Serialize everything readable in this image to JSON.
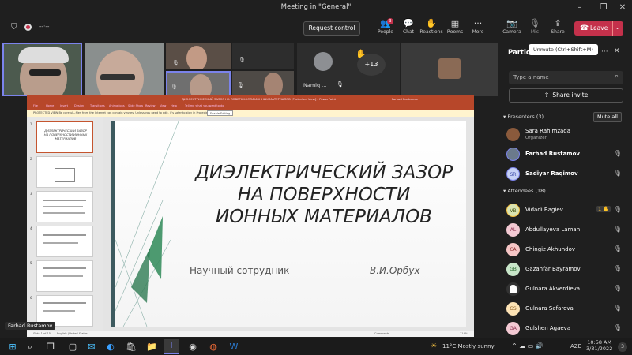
{
  "window": {
    "title": "Meeting in \"General\""
  },
  "toolbar": {
    "timer": "--:--",
    "request_control": "Request control",
    "people": {
      "label": "People",
      "badge": "3"
    },
    "chat": "Chat",
    "reactions": "Reactions",
    "rooms": "Rooms",
    "more": "More",
    "camera": "Camera",
    "mic": "Mic",
    "share": "Share",
    "leave": "Leave"
  },
  "video": {
    "namiq_label": "Namiq ...",
    "more_count": "+13",
    "speaker_label": "Farhad Rustamov"
  },
  "powerpoint": {
    "title_bar": "ДИЭЛЕКТРИЧЕСКИЙ ЗАЗОР НА ПОВЕРХНОСТИ ИОННЫХ МАТЕРИАЛОВ [Protected View] - PowerPoint",
    "user": "Farhad Rustamov",
    "tabs": [
      "File",
      "Home",
      "Insert",
      "Design",
      "Transitions",
      "Animations",
      "Slide Show",
      "Review",
      "View",
      "Help"
    ],
    "tell_me": "Tell me what you want to do",
    "protected_msg": "PROTECTED VIEW  Be careful—files from the Internet can contain viruses. Unless you need to edit, it's safer to stay in Protected View.",
    "enable_editing": "Enable Editing",
    "status_left": "Slide 1 of 15",
    "status_lang": "English (United States)",
    "status_comments": "Comments",
    "status_zoom": "114%",
    "thumbnail_numbers": [
      "1",
      "2",
      "3",
      "4",
      "5",
      "6"
    ],
    "thumb1_text": "ДИЭЛЕКТРИЧЕСКИЙ ЗАЗОР НА ПОВЕРХНОСТИ ИОННЫХ МАТЕРИАЛОВ",
    "slide": {
      "title_line1": "ДИЭЛЕКТРИЧЕСКИЙ  ЗАЗОР",
      "title_line2": "НА ПОВЕРХНОСТИ",
      "title_line3": "ИОННЫХ МАТЕРИАЛОВ",
      "subtitle_left": "Научный сотрудник",
      "subtitle_right": "В.И.Орбух"
    }
  },
  "participants": {
    "header": "Partic",
    "tooltip": "Unmute (Ctrl+Shift+M)",
    "search_placeholder": "Type a name",
    "share_invite": "Share invite",
    "presenters_label": "Presenters (3)",
    "mute_all": "Mute all",
    "attendees_label": "Attendees (18)",
    "presenters": [
      {
        "name": "Sara Rahimzada",
        "role": "Organizer",
        "initials": "",
        "color": "#8a5a3c"
      },
      {
        "name": "Farhad Rustamov",
        "initials": "",
        "color": "#6b7a8c"
      },
      {
        "name": "Sadiyar Raqimov",
        "initials": "SR",
        "color": "#c5d0f5"
      }
    ],
    "attendees": [
      {
        "name": "Vidadi Bagiev",
        "initials": "VB",
        "color": "#d9e3b2",
        "hand": "1"
      },
      {
        "name": "Abdullayeva Laman",
        "initials": "AL",
        "color": "#f3c9d3"
      },
      {
        "name": "Chingiz Akhundov",
        "initials": "CA",
        "color": "#f6c6c6"
      },
      {
        "name": "Gazanfar Bayramov",
        "initials": "GB",
        "color": "#c8e6c9"
      },
      {
        "name": "Gulnara Akverdieva",
        "initials": "",
        "color": "#333333"
      },
      {
        "name": "Gulnara Safarova",
        "initials": "GS",
        "color": "#fde3b5"
      },
      {
        "name": "Gulshen Agaeva",
        "initials": "GA",
        "color": "#f3c9d3"
      }
    ]
  },
  "taskbar": {
    "weather": "11°C  Mostly sunny",
    "lang": "AZE",
    "time": "10:58 AM",
    "date": "3/31/2022",
    "notif": "3"
  }
}
